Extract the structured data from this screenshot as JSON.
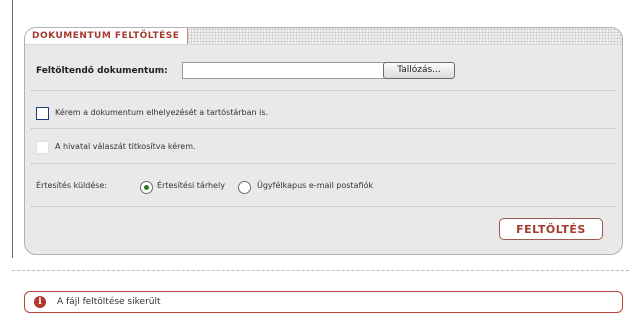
{
  "panel": {
    "title": "DOKUMENTUM FELTÖLTÉSE",
    "file_label": "Feltöltendő dokumentum:",
    "file_value": "",
    "browse_label": "Tallózás...",
    "checkbox_store": {
      "label": "Kérem a dokumentum elhelyezését a tartóstárban is.",
      "checked": false
    },
    "checkbox_encrypt": {
      "label": "A hivatal válaszát titkosítva kérem.",
      "checked": false
    },
    "notify": {
      "label": "Értesítés küldése:",
      "options": [
        {
          "label": "Értesítési tárhely",
          "selected": true
        },
        {
          "label": "Ügyfélkapus e-mail postafiók",
          "selected": false
        }
      ]
    },
    "upload_label": "FELTÖLTÉS"
  },
  "message": {
    "icon": "info-icon",
    "text": "A fájl feltöltése sikerült"
  },
  "colors": {
    "accent": "#a33b2e",
    "radio_selected": "#2b7a1d",
    "panel_bg": "#e9e9e9"
  }
}
